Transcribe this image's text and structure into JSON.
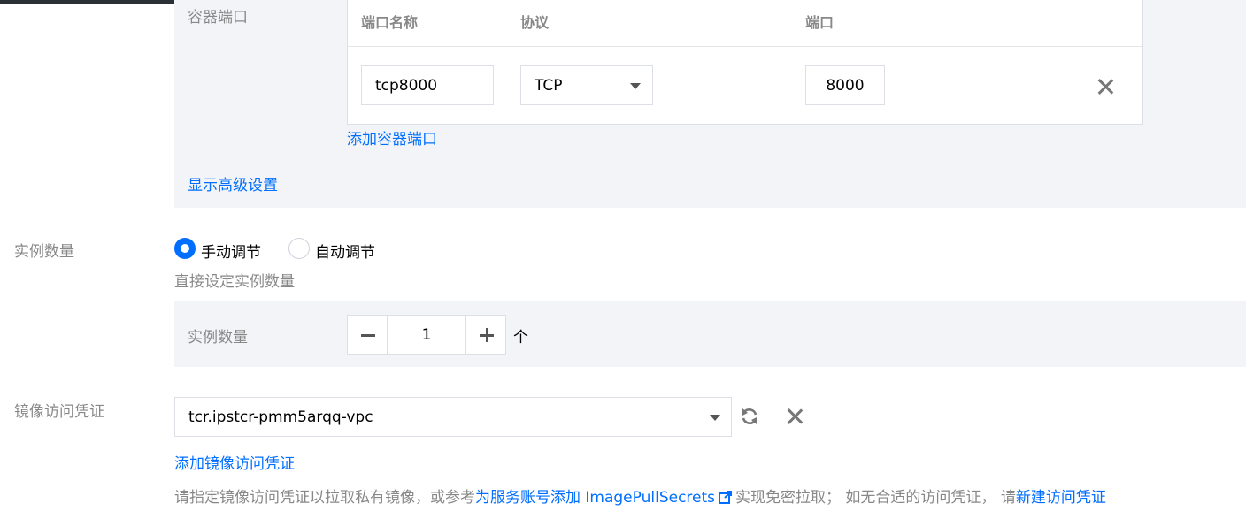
{
  "container_ports": {
    "section_label": "容器端口",
    "columns": [
      "端口名称",
      "协议",
      "端口"
    ],
    "rows": [
      {
        "name": "tcp8000",
        "protocol": "TCP",
        "port": "8000"
      }
    ],
    "add_link": "添加容器端口",
    "advanced_link": "显示高级设置"
  },
  "instances": {
    "label": "实例数量",
    "options": [
      "手动调节",
      "自动调节"
    ],
    "selected": "手动调节",
    "description": "直接设定实例数量",
    "count_label": "实例数量",
    "count_value": "1",
    "unit": "个"
  },
  "image_credential": {
    "label": "镜像访问凭证",
    "selected": "tcr.ipstcr-pmm5arqq-vpc",
    "add_link": "添加镜像访问凭证",
    "hint_prefix": "请指定镜像访问凭证以拉取私有镜像，或参考",
    "hint_link1": "为服务账号添加 ImagePullSecrets",
    "hint_middle": "实现免密拉取；  如无合适的访问凭证，  请",
    "hint_link2": "新建访问凭证"
  },
  "colors": {
    "accent": "#006eff",
    "panel_bg": "#f3f4f7",
    "muted_text": "#888888"
  },
  "icons": [
    "caret-down-icon",
    "close-icon",
    "refresh-icon",
    "external-link-icon",
    "minus-icon",
    "plus-icon"
  ]
}
